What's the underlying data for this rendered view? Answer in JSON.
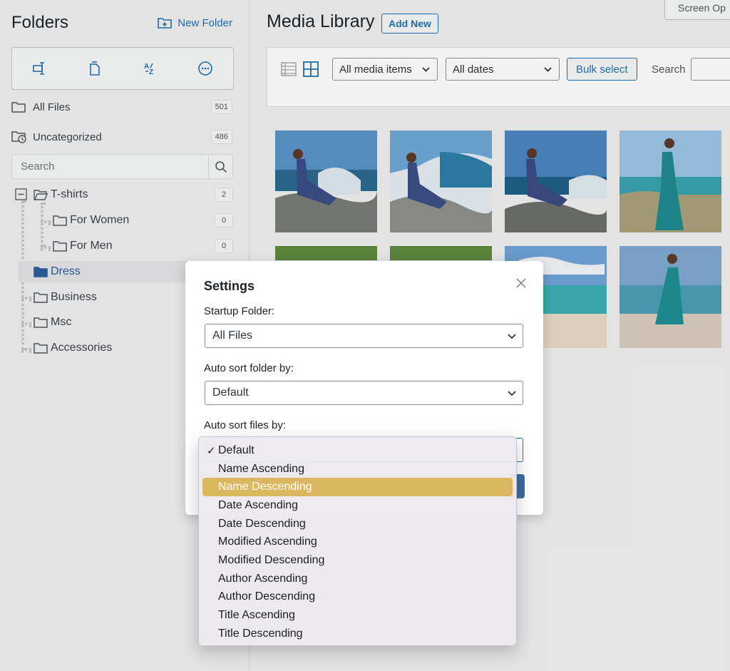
{
  "sidebar": {
    "title": "Folders",
    "new_folder_label": "New Folder",
    "toolbar_icons": [
      "rename-icon",
      "new-file-icon",
      "sort-az-icon",
      "more-icon"
    ],
    "all_files": {
      "label": "All Files",
      "count": "501"
    },
    "uncategorized": {
      "label": "Uncategorized",
      "count": "486"
    },
    "search_placeholder": "Search",
    "tree": {
      "tshirts": {
        "label": "T-shirts",
        "count": "2"
      },
      "for_women": {
        "label": "For Women",
        "count": "0"
      },
      "for_men": {
        "label": "For Men",
        "count": "0"
      },
      "dress": {
        "label": "Dress"
      },
      "business": {
        "label": "Business"
      },
      "msc": {
        "label": "Msc"
      },
      "accessories": {
        "label": "Accessories"
      }
    }
  },
  "main": {
    "screen_options": "Screen Op",
    "title": "Media Library",
    "add_new": "Add New",
    "filters": {
      "media_type": "All media items",
      "dates": "All dates",
      "bulk_select": "Bulk select",
      "search_label": "Search"
    }
  },
  "modal": {
    "title": "Settings",
    "startup_label": "Startup Folder:",
    "startup_value": "All Files",
    "sort_folder_label": "Auto sort folder by:",
    "sort_folder_value": "Default",
    "sort_files_label": "Auto sort files by:"
  },
  "dropdown": {
    "selected_check": "✓",
    "options": [
      "Default",
      "Name Ascending",
      "Name Descending",
      "Date Ascending",
      "Date Descending",
      "Modified Ascending",
      "Modified Descending",
      "Author Ascending",
      "Author Descending",
      "Title Ascending",
      "Title Descending"
    ],
    "selected_index": 0,
    "highlighted_index": 2
  },
  "colors": {
    "accent": "#2271b1",
    "highlight": "#dbb860",
    "folder_active": "#2c5d9e"
  }
}
